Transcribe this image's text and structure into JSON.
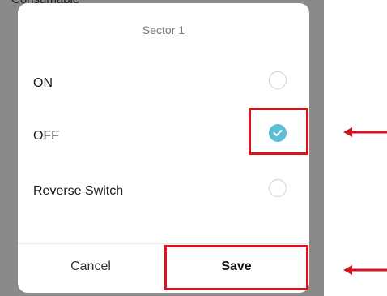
{
  "background": {
    "partial_text": "Consumable"
  },
  "dialog": {
    "title": "Sector 1",
    "options": [
      {
        "label": "ON",
        "selected": false
      },
      {
        "label": "OFF",
        "selected": true
      },
      {
        "label": "Reverse Switch",
        "selected": false
      }
    ],
    "cancel_label": "Cancel",
    "save_label": "Save"
  },
  "colors": {
    "accent_radio": "#5bbfd6",
    "annotation_red": "#d9131e",
    "backdrop": "#8a8a8a"
  },
  "annotations": {
    "icons": [
      "checkmark-icon",
      "arrow-left-icon"
    ]
  }
}
